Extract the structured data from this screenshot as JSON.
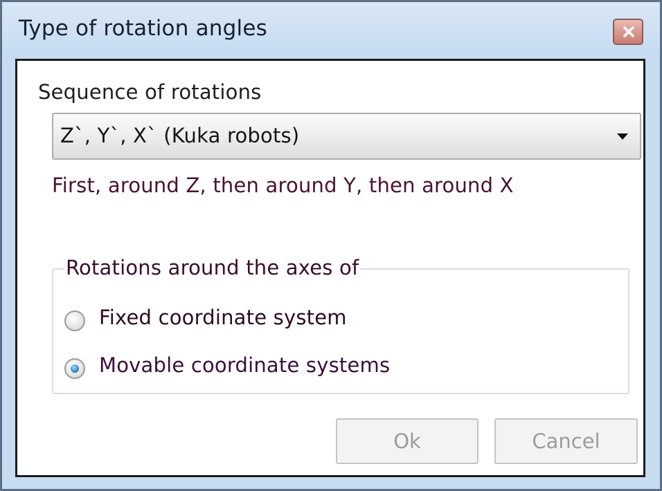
{
  "window": {
    "title": "Type of rotation angles",
    "close_icon": "close-icon"
  },
  "sequence": {
    "label": "Sequence of rotations",
    "selected_value": "Z`, Y`, X` (Kuka robots)",
    "dropdown_icon": "chevron-down-icon",
    "description": "First, around Z, then around Y, then around X"
  },
  "rotations_group": {
    "title": "Rotations around the axes of",
    "options": [
      {
        "label": "Fixed coordinate system",
        "selected": false
      },
      {
        "label": "Movable coordinate systems",
        "selected": true
      }
    ]
  },
  "buttons": {
    "ok_label": "Ok",
    "cancel_label": "Cancel",
    "ok_enabled": false,
    "cancel_enabled": false
  },
  "colors": {
    "titlebar": "#c7dcf1",
    "radio_selected": "#3b8ec8",
    "disabled_text": "#9c9c9c"
  }
}
